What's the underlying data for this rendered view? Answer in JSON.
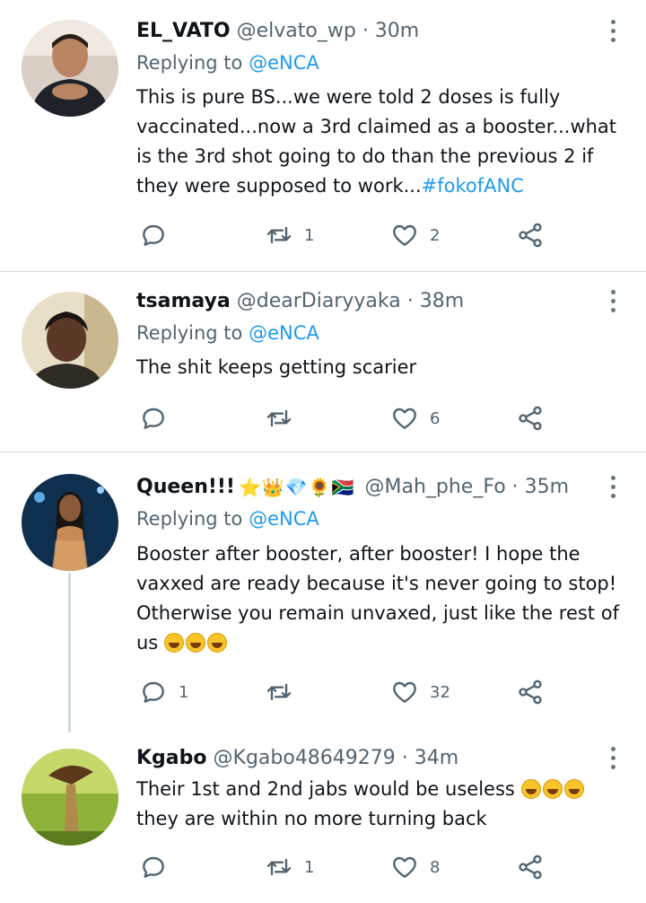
{
  "tweets": [
    {
      "name": "EL_VATO",
      "handle": "@elvato_wp",
      "time": "· 30m",
      "replying_prefix": "Replying to ",
      "replying_to": "@eNCA",
      "text": "This is pure BS...we were told 2 doses is fully vaccinated...now a 3rd claimed as a booster...what is the 3rd shot going to do than the previous 2 if they were supposed to work...",
      "hashtag": "#fokofANC",
      "replies": "",
      "retweets": "1",
      "likes": "2"
    },
    {
      "name": "tsamaya",
      "handle": "@dearDiaryyaka",
      "time": "· 38m",
      "replying_prefix": "Replying to ",
      "replying_to": "@eNCA",
      "text": "The shit keeps getting scarier",
      "replies": "",
      "retweets": "",
      "likes": "6"
    },
    {
      "name": "Queen!!!",
      "name_emojis": "⭐👑💎🌻🇿🇦",
      "handle": "@Mah_phe_Fo",
      "time": "· 35m",
      "replying_prefix": "Replying to ",
      "replying_to": "@eNCA",
      "text": "Booster after booster, after booster! I hope the vaxxed are ready because it's never going to stop! Otherwise you remain unvaxed, just like the rest of us",
      "replies": "1",
      "retweets": "",
      "likes": "32"
    },
    {
      "name": "Kgabo",
      "handle": "@Kgabo48649279",
      "time": "· 34m",
      "text": "Their 1st and 2nd jabs would be useless",
      "text_line2": "they are within no more turning back",
      "replies": "",
      "retweets": "1",
      "likes": "8"
    }
  ],
  "icons": {
    "reply": "reply-icon",
    "retweet": "retweet-icon",
    "like": "heart-icon",
    "share": "share-icon",
    "more": "more-vertical-icon"
  },
  "colors": {
    "link": "#1d9bf0",
    "secondary_text": "#536471",
    "divider": "#cfd9de"
  }
}
